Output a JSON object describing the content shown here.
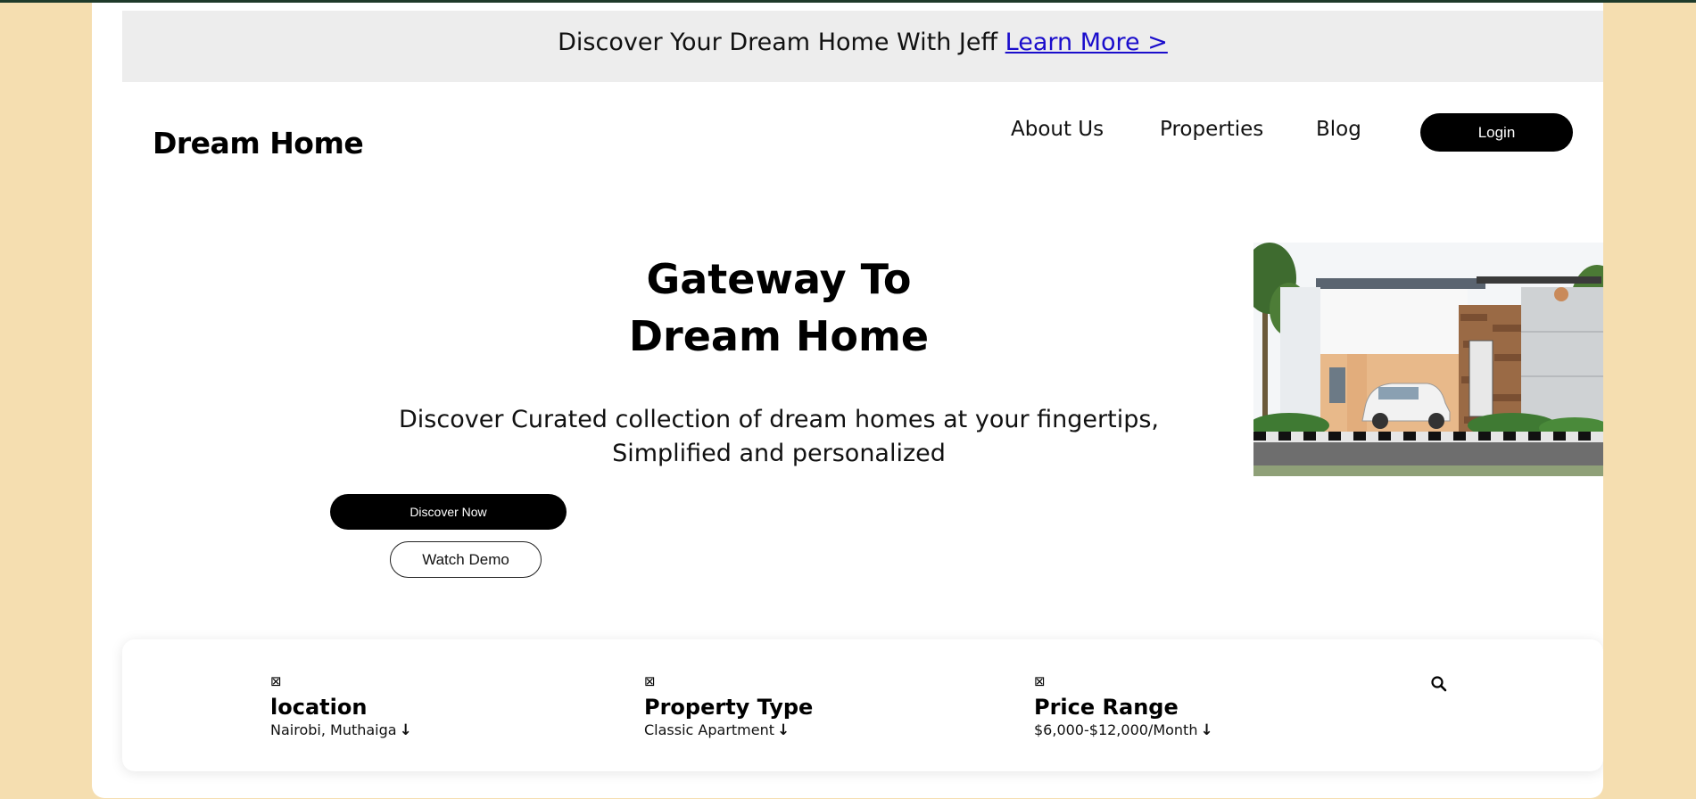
{
  "announcement": {
    "text": "Discover Your Dream Home With Jeff",
    "link": "Learn More >"
  },
  "header": {
    "brand": "Dream Home",
    "nav": [
      "About Us",
      "Properties",
      "Blog"
    ],
    "login": "Login"
  },
  "hero": {
    "title_line1": "Gateway To",
    "title_line2": "Dream Home",
    "subtitle_line1": "Discover Curated collection of dream homes at your fingertips,",
    "subtitle_line2": "Simplified and personalized",
    "primary_button": "Discover Now",
    "secondary_button": "Watch Demo",
    "image_icon": "house-photo"
  },
  "search": {
    "fields": [
      {
        "icon": "⊠",
        "label": "location",
        "value": "Nairobi, Muthaiga"
      },
      {
        "icon": "⊠",
        "label": "Property Type",
        "value": "Classic Apartment"
      },
      {
        "icon": "⊠",
        "label": "Price Range",
        "value": "$6,000-$12,000/Month"
      }
    ],
    "dropdown_arrow": "↓",
    "search_icon": "search-icon"
  },
  "colors": {
    "page_background": "#f5deb0",
    "announcement_bg": "#ededed",
    "link": "#1a0dcc",
    "button_dark": "#000000"
  }
}
